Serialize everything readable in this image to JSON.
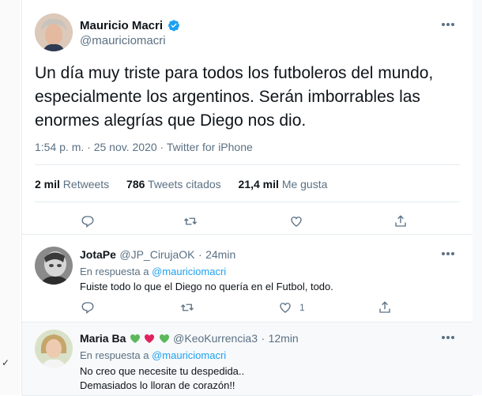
{
  "main_tweet": {
    "author_name": "Mauricio Macri",
    "author_handle": "@mauriciomacri",
    "text_line1": "Un día muy triste para todos los futboleros del mundo,",
    "text_line2": "especialmente los argentinos. Serán imborrables las",
    "text_line3": "enormes alegrías que Diego nos dio.",
    "time": "1:54 p. m.",
    "sep": "·",
    "date": "25 nov. 2020",
    "source": "Twitter for iPhone",
    "retweets_count": "2 mil",
    "retweets_label": "Retweets",
    "quotes_count": "786",
    "quotes_label": "Tweets citados",
    "likes_count": "21,4 mil",
    "likes_label": "Me gusta"
  },
  "replies": [
    {
      "name": "JotaPe",
      "handle": "@JP_CirujaOK",
      "sep": "·",
      "time": "24min",
      "in_reply_prefix": "En respuesta a",
      "in_reply_mention": "@mauriciomacri",
      "text_line1": "Fuiste todo lo que el Diego no quería en el Futbol, todo.",
      "text_line2": "",
      "like_count": "1"
    },
    {
      "name": "Maria Ba",
      "handle": "@KeoKurrencia3",
      "sep": "·",
      "time": "12min",
      "in_reply_prefix": "En respuesta a",
      "in_reply_mention": "@mauriciomacri",
      "text_line1": "No creo que necesite tu despedida..",
      "text_line2": "Demasiados lo lloran de corazón!!"
    }
  ],
  "colors": {
    "accent": "#1da1f2",
    "muted": "#5b7083",
    "text": "#0f1419",
    "green_heart": "#5cb85c",
    "pink_heart": "#e0245e"
  }
}
